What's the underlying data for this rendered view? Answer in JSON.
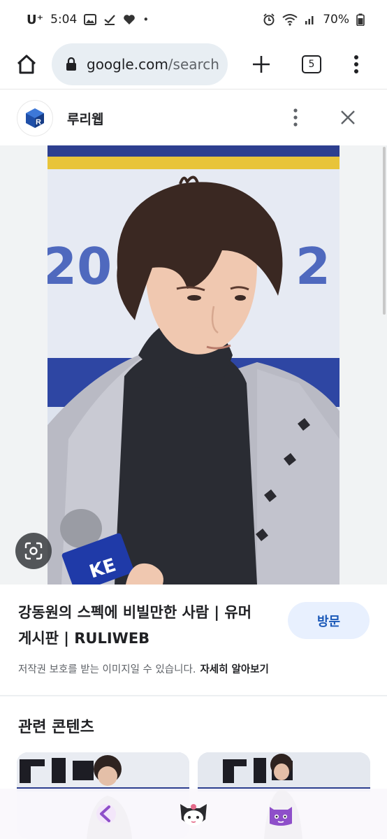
{
  "status_bar": {
    "carrier": "U⁺",
    "time": "5:04",
    "battery": "70%"
  },
  "toolbar": {
    "url_domain": "google.com",
    "url_path": "/search",
    "tab_count": "5"
  },
  "site": {
    "name": "루리웹"
  },
  "photo": {
    "banner_text_left": "20",
    "banner_text_right": "2",
    "mic_label": "KE"
  },
  "result": {
    "title": "강동원의 스펙에 비빌만한 사람 | 유머 게시판 | RULIWEB",
    "visit_label": "방문",
    "copyright_notice": "저작권 보호를 받는 이미지일 수 있습니다.",
    "learn_more_label": "자세히 알아보기"
  },
  "related": {
    "heading": "관련 콘텐츠"
  },
  "colors": {
    "url_bar_bg": "#e8eef3",
    "visit_bg": "#e8f0fe",
    "visit_text": "#1a58b8",
    "nav_icon": "#8e4fc9"
  },
  "icons": [
    "home-icon",
    "lock-icon",
    "plus-icon",
    "tabs-icon",
    "more-vert-icon",
    "close-icon",
    "lens-icon",
    "back-icon",
    "cat-icon",
    "ghost-icon"
  ]
}
